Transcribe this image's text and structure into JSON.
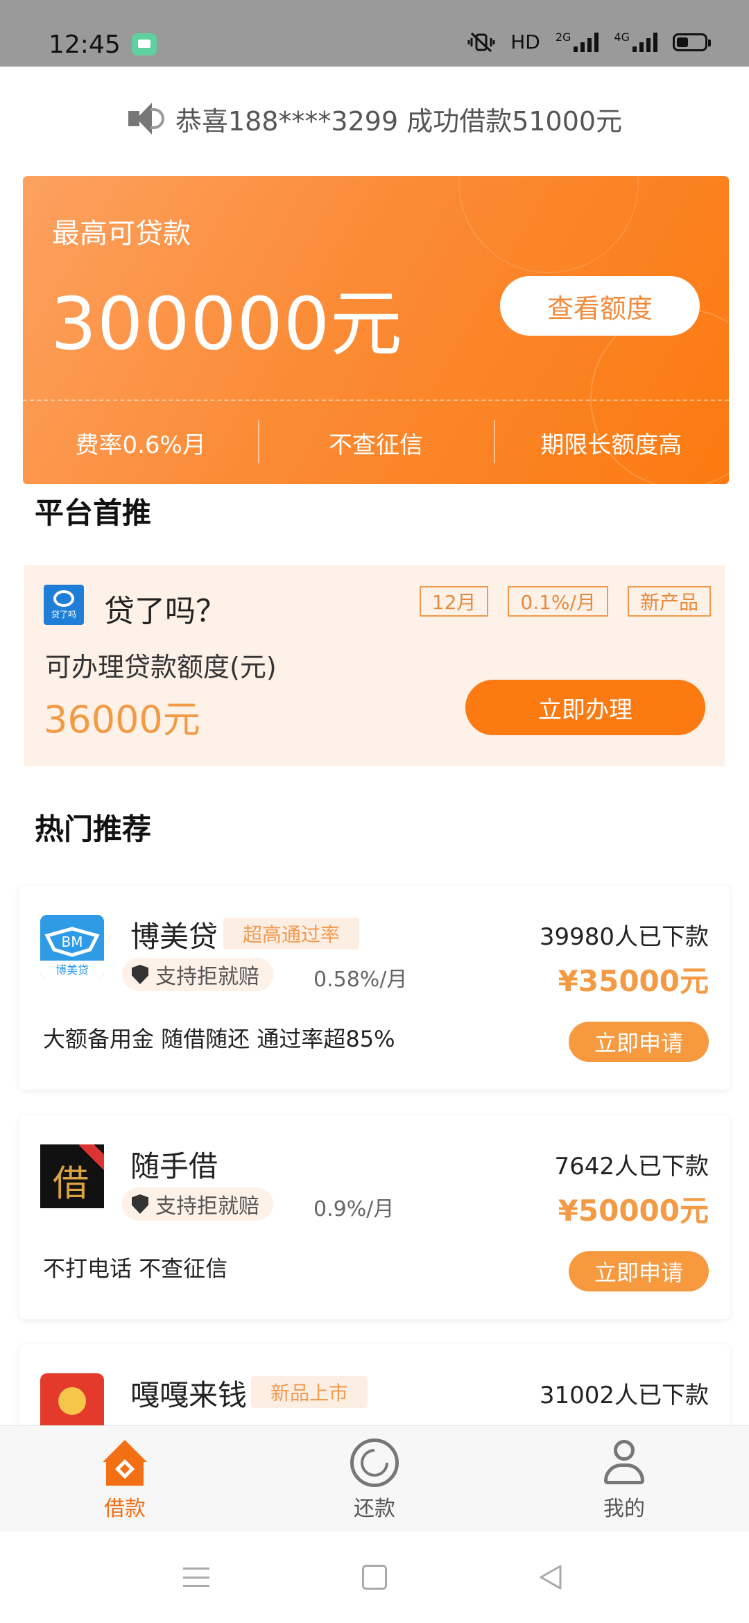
{
  "status_bar": {
    "time": "12:45",
    "network": "HD",
    "net_2g": "2G",
    "net_4g": "4G"
  },
  "marquee": {
    "text": "恭喜188****3299 成功借款51000元"
  },
  "hero": {
    "label": "最高可贷款",
    "amount": "300000元",
    "button": "查看额度",
    "features": [
      "费率0.6%月",
      "不查征信",
      "期限长额度高"
    ]
  },
  "featured_section": {
    "title": "平台首推",
    "product": {
      "logo_text": "贷了吗",
      "name": "贷了吗？",
      "tags": [
        "12月",
        "0.1%/月",
        "新产品"
      ],
      "subtitle": "可办理贷款额度(元)",
      "amount": "36000元",
      "button": "立即办理"
    }
  },
  "hot_section": {
    "title": "热门推荐",
    "products": [
      {
        "name": "博美贷",
        "logo_text": "博美贷",
        "badge": "超高通过率",
        "pill": "支持拒就赔",
        "rate": "0.58%/月",
        "downloads": "39980人已下款",
        "loan": "¥35000元",
        "desc": "大额备用金 随借随还 通过率超85%",
        "button": "立即申请"
      },
      {
        "name": "随手借",
        "logo_text": "借",
        "badge": "",
        "pill": "支持拒就赔",
        "rate": "0.9%/月",
        "downloads": "7642人已下款",
        "loan": "¥50000元",
        "desc": "不打电话 不查征信",
        "button": "立即申请"
      },
      {
        "name": "嘎嘎来钱",
        "badge": "新品上市",
        "downloads": "31002人已下款"
      }
    ]
  },
  "tab_bar": {
    "tabs": [
      {
        "label": "借款"
      },
      {
        "label": "还款"
      },
      {
        "label": "我的"
      }
    ]
  },
  "colors": {
    "accent": "#fb7a12",
    "accent_light": "#f39a45",
    "card_bg": "#fdf1e8"
  }
}
